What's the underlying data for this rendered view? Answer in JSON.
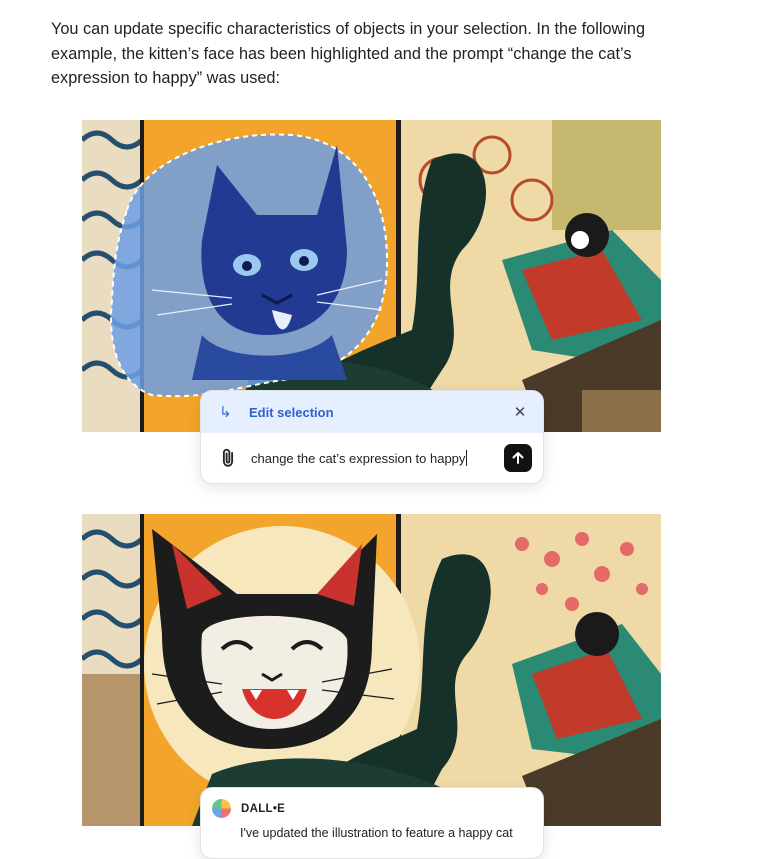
{
  "intro": {
    "line1": "You can update specific characteristics of objects in your selection. In the following",
    "line2": "example, the kitten’s face has been highlighted and the prompt “change the cat’s",
    "line3": "expression to happy” was used:"
  },
  "edit_panel": {
    "title": "Edit selection",
    "arrow_glyph": "↳",
    "close_glyph": "✕",
    "prompt": "change the cat’s expression to happy"
  },
  "dalle_card": {
    "name": "DALL•E",
    "message": "I've updated the illustration to feature a happy cat"
  },
  "colors": {
    "selection_overlay": "#6e9fe3",
    "header_bg": "#e6efff",
    "accent": "#2f62cc"
  },
  "icons": [
    "arrow-turn-icon",
    "close-icon",
    "paperclip-icon",
    "arrow-up-icon",
    "dalle-avatar-icon"
  ]
}
